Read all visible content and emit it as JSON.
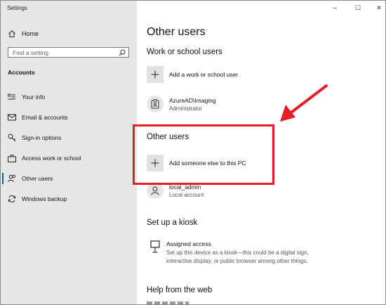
{
  "window": {
    "title": "Settings",
    "minimize": "–",
    "maximize": "☐",
    "close": "✕"
  },
  "sidebar": {
    "home_label": "Home",
    "search_placeholder": "Find a setting",
    "section_heading": "Accounts",
    "items": [
      {
        "label": "Your info",
        "icon": "person-card-icon"
      },
      {
        "label": "Email & accounts",
        "icon": "mail-icon"
      },
      {
        "label": "Sign-in options",
        "icon": "key-icon"
      },
      {
        "label": "Access work or school",
        "icon": "briefcase-icon"
      },
      {
        "label": "Other users",
        "icon": "people-icon",
        "active": true
      },
      {
        "label": "Windows backup",
        "icon": "sync-icon"
      }
    ]
  },
  "main": {
    "page_title": "Other users",
    "work_section": {
      "heading": "Work or school users",
      "add_label": "Add a work or school user",
      "user_name": "AzureAD\\Imaging",
      "user_role": "Administrator"
    },
    "other_section": {
      "heading": "Other users",
      "add_label": "Add someone else to this PC",
      "user_name": "local_admin",
      "user_role": "Local account"
    },
    "kiosk_section": {
      "heading": "Set up a kiosk",
      "title": "Assigned access",
      "description": "Set up this device as a kiosk—this could be a digital sign, interactive display, or public browser among other things."
    },
    "help_section": {
      "heading": "Help from the web"
    }
  },
  "colors": {
    "accent": "#0063b1",
    "annotation": "#e21f26",
    "sidebar_bg": "#e6e6e6"
  }
}
